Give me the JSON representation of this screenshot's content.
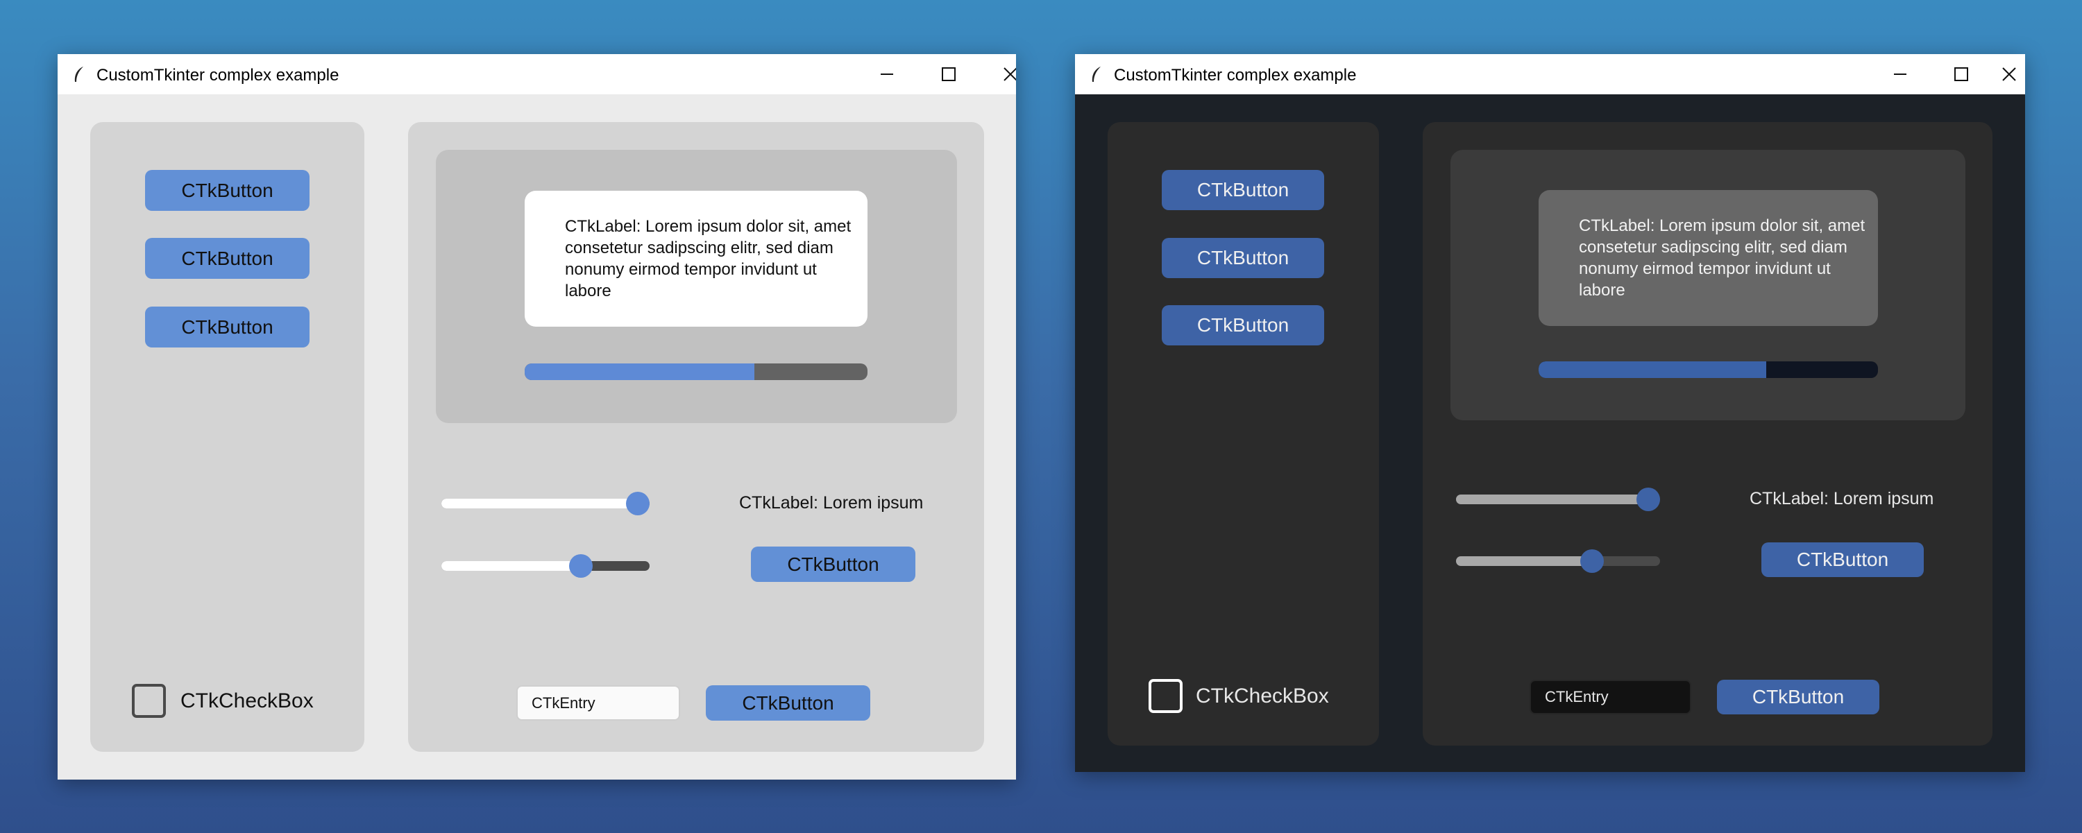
{
  "windows": [
    {
      "theme": "light",
      "title": "CustomTkinter complex example",
      "sidebar_buttons": [
        "CTkButton",
        "CTkButton",
        "CTkButton"
      ],
      "checkbox_label": "CTkCheckBox",
      "label_text": "CTkLabel: Lorem ipsum dolor sit, amet consetetur sadipscing elitr, sed diam nonumy eirmod tempor invidunt ut labore",
      "progress": 0.67,
      "slider1_value": 1.0,
      "slider2_value": 0.69,
      "side_label": "CTkLabel: Lorem ipsum",
      "side_button": "CTkButton",
      "entry_placeholder": "CTkEntry",
      "bottom_button": "CTkButton"
    },
    {
      "theme": "dark",
      "title": "CustomTkinter complex example",
      "sidebar_buttons": [
        "CTkButton",
        "CTkButton",
        "CTkButton"
      ],
      "checkbox_label": "CTkCheckBox",
      "label_text": "CTkLabel: Lorem ipsum dolor sit, amet consetetur sadipscing elitr, sed diam nonumy eirmod tempor invidunt ut labore",
      "progress": 0.67,
      "slider1_value": 1.0,
      "slider2_value": 0.69,
      "side_label": "CTkLabel: Lorem ipsum",
      "side_button": "CTkButton",
      "entry_placeholder": "CTkEntry",
      "bottom_button": "CTkButton"
    }
  ]
}
